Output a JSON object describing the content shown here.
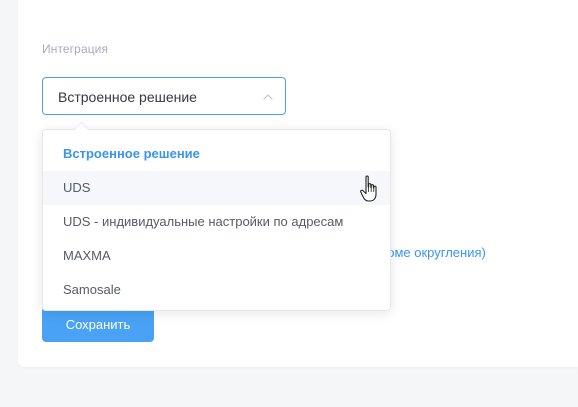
{
  "form": {
    "integration_label": "Интеграция",
    "integration_value": "Встроенное решение",
    "hint_text": "роме округления)",
    "save_label": "Сохранить"
  },
  "dropdown": {
    "options": [
      {
        "label": "Встроенное решение",
        "state": "selected"
      },
      {
        "label": "UDS",
        "state": "hover"
      },
      {
        "label": "UDS - индивидуальные настройки по адресам",
        "state": "normal"
      },
      {
        "label": "MAXMA",
        "state": "normal"
      },
      {
        "label": "Samosale",
        "state": "normal"
      }
    ]
  },
  "colors": {
    "accent": "#49a2f5",
    "selected_text": "#3a95ee",
    "label_text": "#a5aebb",
    "hover_bg": "#f5f7fa"
  },
  "icons": {
    "select_chevron": "chevron-up-icon",
    "pointer": "hand-pointer-icon"
  }
}
